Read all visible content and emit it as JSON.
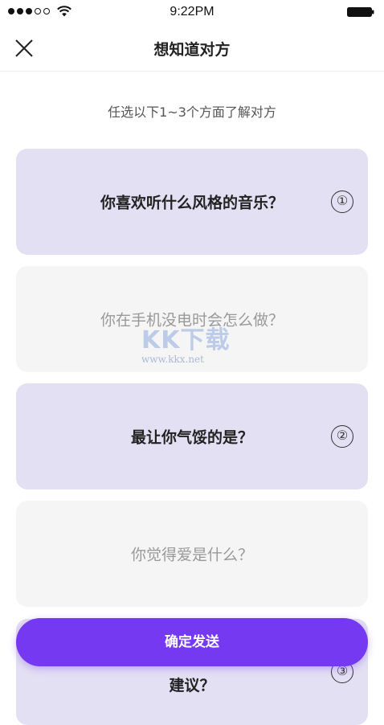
{
  "status_bar": {
    "time": "9:22PM",
    "signal_dots_filled": 3,
    "signal_dots_total": 5
  },
  "nav": {
    "title": "想知道对方"
  },
  "subtitle": "任选以下1~3个方面了解对方",
  "questions": [
    {
      "text": "你喜欢听什么风格的音乐？",
      "selected": true,
      "order": "①"
    },
    {
      "text": "你在手机没电时会怎么做？",
      "selected": false,
      "order": ""
    },
    {
      "text": "最让你气馁的是？",
      "selected": true,
      "order": "②"
    },
    {
      "text": "你觉得爱是什么？",
      "selected": false,
      "order": ""
    },
    {
      "text": "建议？",
      "selected": true,
      "order": "③"
    }
  ],
  "send_button": {
    "label": "确定发送"
  },
  "watermark": {
    "logo": "KK下载",
    "url": "www.kkx.net"
  },
  "colors": {
    "accent": "#7439f0",
    "selected_card": "#e4e0f3",
    "unselected_card": "#f5f5f5"
  }
}
